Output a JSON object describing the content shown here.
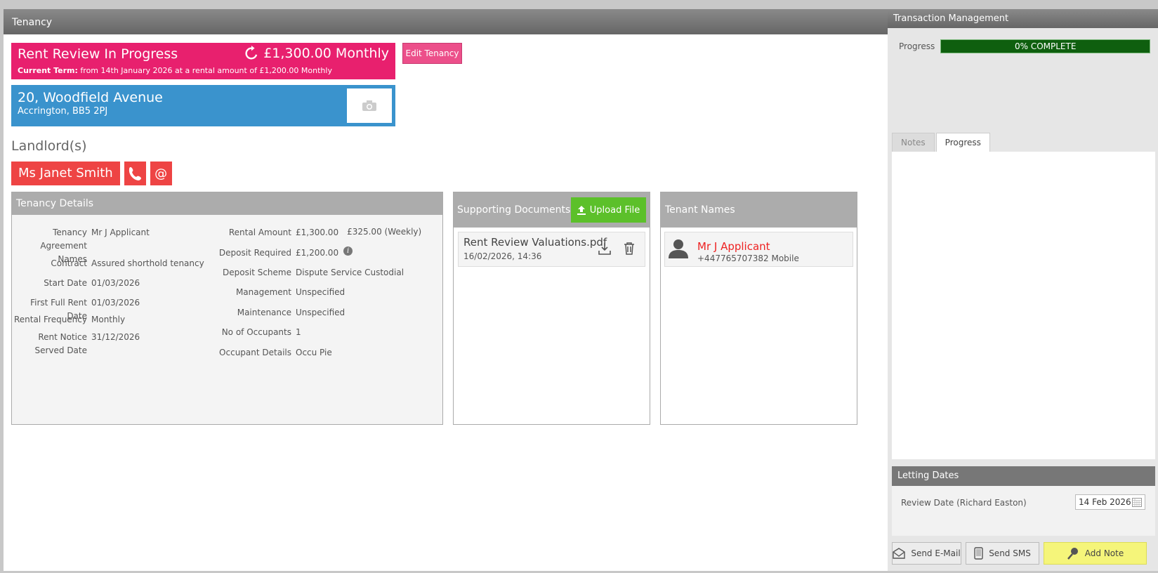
{
  "main": {
    "header_title": "Tenancy",
    "status": {
      "title": "Rent Review In Progress",
      "amount": "£1,300.00 Monthly",
      "term_label": "Current Term:",
      "term_text": " from 14th January 2026 at a rental amount of £1,200.00 Monthly"
    },
    "edit_button": "Edit Tenancy",
    "property": {
      "line1": "20, Woodfield Avenue",
      "line2": "Accrington, BB5 2PJ"
    },
    "landlords": {
      "heading": "Landlord(s)",
      "name": "Ms Janet Smith",
      "email_icon_glyph": "@"
    },
    "details": {
      "heading": "Tenancy Details",
      "left": [
        {
          "label": "Tenancy Agreement Names",
          "value": "Mr J Applicant"
        },
        {
          "label": "Contract",
          "value": "Assured shorthold tenancy"
        },
        {
          "label": "Start Date",
          "value": "01/03/2026"
        },
        {
          "label": "First Full Rent Date",
          "value": "01/03/2026"
        },
        {
          "label": "Rental Frequency",
          "value": "Monthly"
        },
        {
          "label": "Rent Notice Served Date",
          "value": "31/12/2026"
        }
      ],
      "right": [
        {
          "label": "Rental Amount",
          "value": "£1,300.00",
          "extra": "£325.00 (Weekly)"
        },
        {
          "label": "Deposit Required",
          "value": "£1,200.00"
        },
        {
          "label": "Deposit Scheme",
          "value": "Dispute Service Custodial"
        },
        {
          "label": "Management",
          "value": "Unspecified"
        },
        {
          "label": "Maintenance",
          "value": "Unspecified"
        },
        {
          "label": "No of Occupants",
          "value": "1"
        },
        {
          "label": "Occupant Details",
          "value": "Occu Pie"
        }
      ],
      "info_glyph": "i"
    },
    "documents": {
      "heading": "Supporting Documents",
      "upload_label": "Upload File",
      "items": [
        {
          "name": "Rent Review Valuations.pdf",
          "date": "16/02/2026, 14:36"
        }
      ]
    },
    "tenants": {
      "heading": "Tenant Names",
      "items": [
        {
          "name": "Mr J Applicant",
          "phone": "+447765707382 Mobile"
        }
      ]
    }
  },
  "side": {
    "header_title": "Transaction Management",
    "progress_label": "Progress",
    "progress_text": "0% COMPLETE",
    "progress_value": 0,
    "tabs": [
      {
        "label": "Notes",
        "active": false
      },
      {
        "label": "Progress",
        "active": true
      }
    ],
    "letting_dates": {
      "heading": "Letting Dates",
      "review_label": "Review Date (Richard Easton)",
      "review_value": "14 Feb 2026"
    },
    "actions": {
      "email": "Send E-Mail",
      "sms": "Send SMS",
      "note": "Add Note"
    }
  },
  "colors": {
    "status_pink": "#e8206e",
    "property_blue": "#3a93cd",
    "landlord_red": "#ee4444",
    "upload_green": "#5cc02a",
    "progress_green": "#0f5f0f",
    "note_yellow": "#f5f57a"
  }
}
